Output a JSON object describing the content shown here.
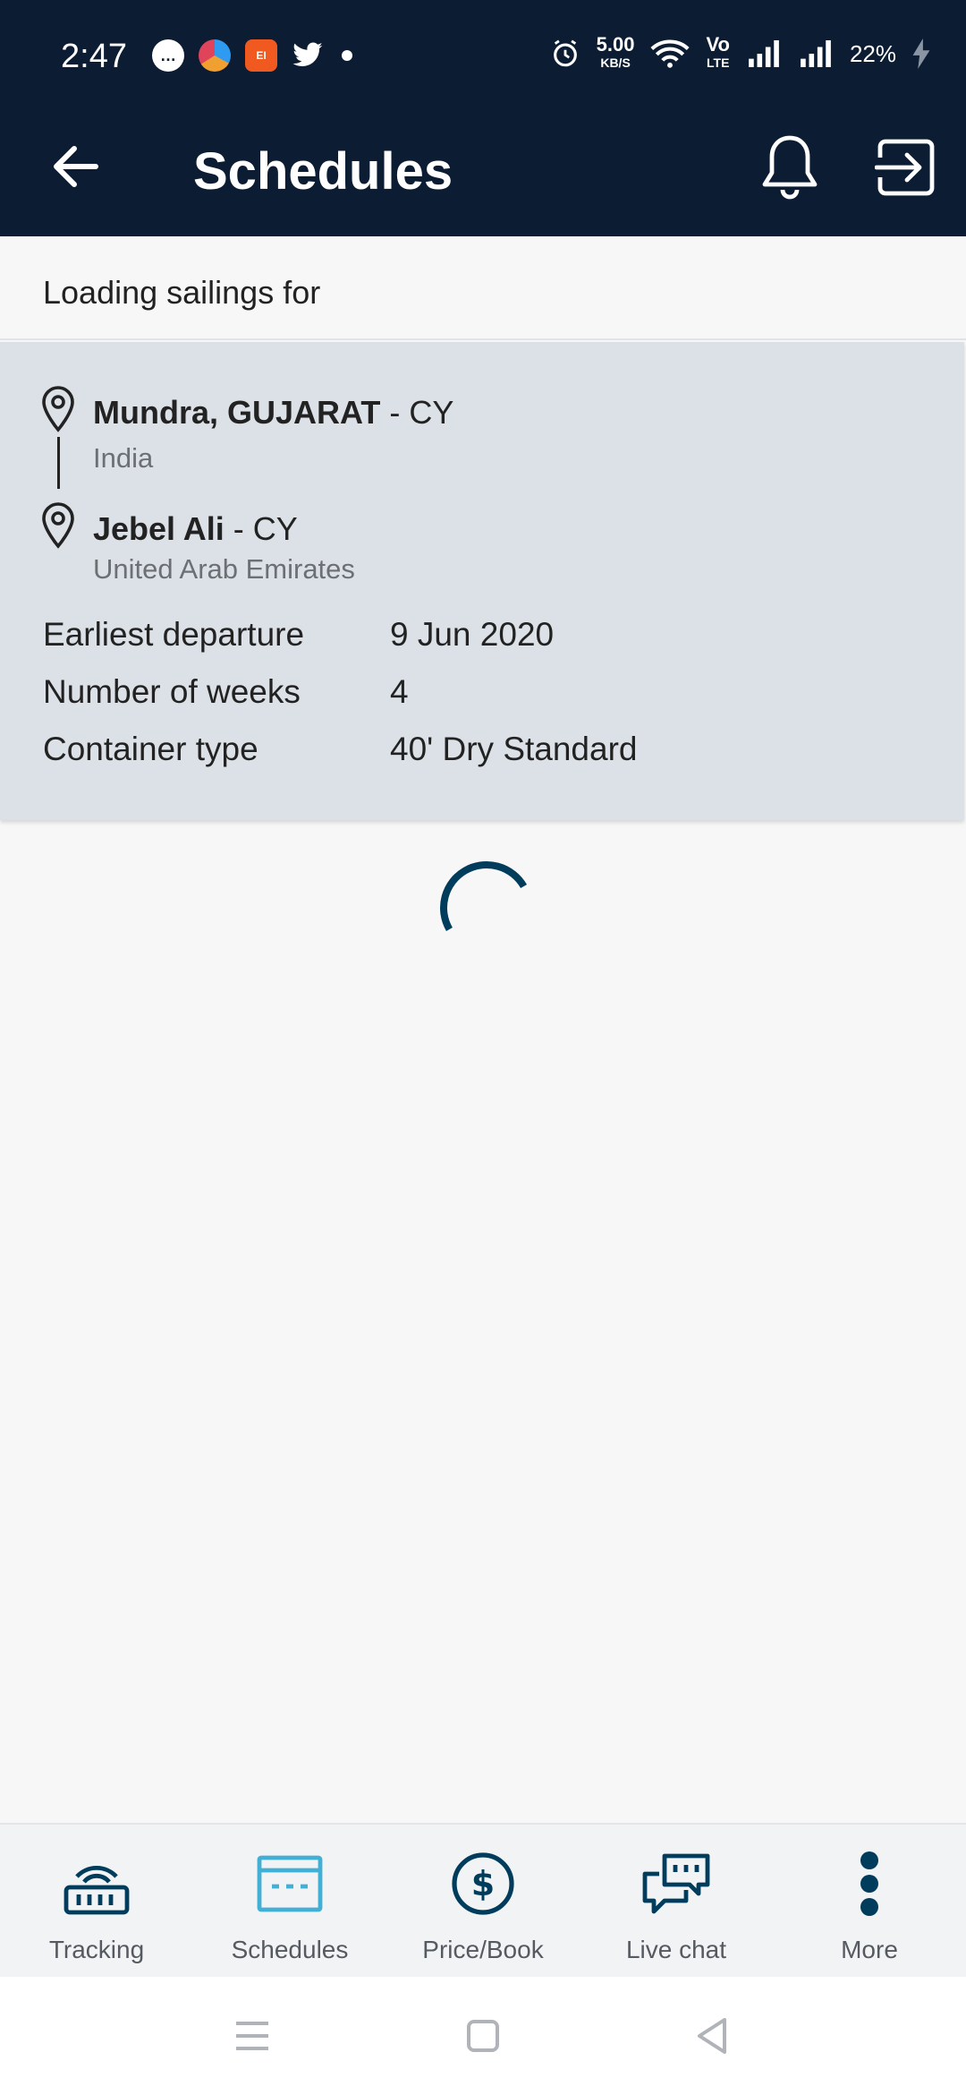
{
  "status_bar": {
    "time": "2:47",
    "net_speed": "5.00",
    "net_unit": "KB/S",
    "volte": "Vo",
    "lte": "LTE",
    "battery": "22%"
  },
  "app_bar": {
    "title": "Schedules"
  },
  "loading": {
    "text": "Loading sailings for"
  },
  "route": {
    "origin": {
      "name": "Mundra, GUJARAT",
      "suffix": " - CY",
      "country": "India"
    },
    "destination": {
      "name": "Jebel Ali",
      "suffix": " - CY",
      "country": "United Arab Emirates"
    }
  },
  "details": [
    {
      "label": "Earliest departure",
      "value": "9 Jun 2020"
    },
    {
      "label": "Number of weeks",
      "value": "4"
    },
    {
      "label": "Container type",
      "value": "40' Dry Standard"
    }
  ],
  "bottom_nav": {
    "items": [
      {
        "label": "Tracking",
        "icon": "tracking-icon",
        "active": false
      },
      {
        "label": "Schedules",
        "icon": "schedules-icon",
        "active": true
      },
      {
        "label": "Price/Book",
        "icon": "price-icon",
        "active": false
      },
      {
        "label": "Live chat",
        "icon": "chat-icon",
        "active": false
      },
      {
        "label": "More",
        "icon": "more-icon",
        "active": false
      }
    ]
  },
  "colors": {
    "header": "#0b1c33",
    "card": "#dbe1e6",
    "accent": "#003d5c",
    "active_nav": "#42b0d5"
  }
}
